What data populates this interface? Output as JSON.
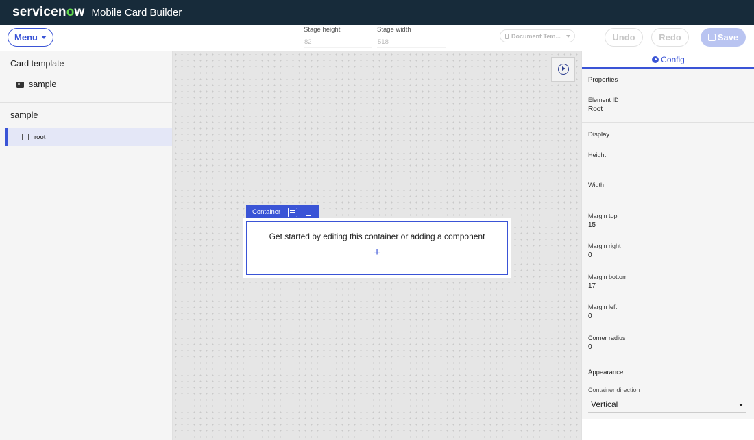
{
  "header": {
    "logo_text_prefix": "servicen",
    "logo_o": "o",
    "logo_text_suffix": "w",
    "app_title": "Mobile Card Builder"
  },
  "toolbar": {
    "menu_label": "Menu",
    "stage_height_label": "Stage height",
    "stage_height_value": "82",
    "stage_width_label": "Stage width",
    "stage_width_value": "518",
    "document_template": "Document Tem...",
    "undo_label": "Undo",
    "redo_label": "Redo",
    "save_label": "Save"
  },
  "left_panel": {
    "card_template_heading": "Card template",
    "card_template_item": "sample",
    "tree_heading": "sample",
    "tree_root": "root"
  },
  "canvas": {
    "container_label": "Container",
    "placeholder_text": "Get started by editing this container or adding a component",
    "add_symbol": "+"
  },
  "right_panel": {
    "tab_label": "Config",
    "properties_heading": "Properties",
    "element_id_label": "Element ID",
    "element_id_value": "Root",
    "display_heading": "Display",
    "height_label": "Height",
    "width_label": "Width",
    "margin_top_label": "Margin top",
    "margin_top_value": "15",
    "margin_right_label": "Margin right",
    "margin_right_value": "0",
    "margin_bottom_label": "Margin bottom",
    "margin_bottom_value": "17",
    "margin_left_label": "Margin left",
    "margin_left_value": "0",
    "corner_radius_label": "Corner radius",
    "corner_radius_value": "0",
    "appearance_heading": "Appearance",
    "container_direction_label": "Container direction",
    "container_direction_value": "Vertical"
  },
  "colors": {
    "header_bg": "#172b3a",
    "accent": "#3a54d6",
    "logo_o": "#62d84e",
    "save_disabled": "#b9c4f1"
  },
  "icons": [
    "card-icon",
    "box-icon",
    "play-icon",
    "settings-sliders-icon",
    "trash-icon",
    "gear-icon",
    "save-icon",
    "phone-icon"
  ]
}
